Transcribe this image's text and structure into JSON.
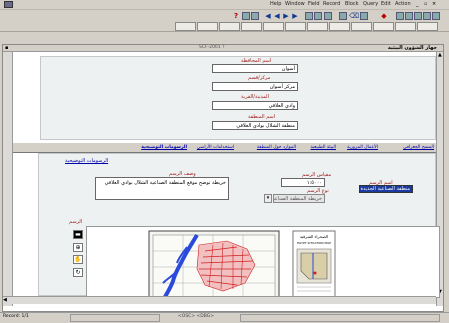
{
  "menu": {
    "items": [
      "Help",
      "Window",
      "Field",
      "Record",
      "Block",
      "Query",
      "Edit",
      "Action"
    ]
  },
  "window": {
    "title_left": "جهاز الشؤون البيئية",
    "title_center": "SCF-2001 ?"
  },
  "upper": {
    "governorate_label": "اسم المحافظة",
    "governorate_value": "أسوان",
    "markaz_label": "مركز/قسم",
    "markaz_value": "مركز أسوان",
    "city_label": "المدينة/القرية",
    "city_value": "وادي العلاقي",
    "area_label": "اسم المنطقة",
    "area_value": "منطقة الشلال بوادي العلاقي"
  },
  "tabs": [
    "المسح الجغرافي",
    "الأعمال المرورية",
    "البيئة الطبيعية",
    "الموارد حول المنطقة",
    "استخدامات الأراضي",
    "الرسومات التوضيحية"
  ],
  "lower": {
    "section_link": "الرسومات التوضيحية",
    "drawing_name_label": "اسم الرسم",
    "drawing_name_value": "منطقة الصناعية الجديدة",
    "scale_label": "مقياس الرسم",
    "scale_value": "١:٥٠٠٠",
    "drawing_type_label": "نوع الرسم",
    "drawing_type_value": "خريطة المنطقة الصناعية",
    "description_label": "وصف الرسم",
    "description_value": "خريطة توضح موقع المنطقة الصناعية الشلال بوادي العلاقي",
    "drawing_label": "الرسم"
  },
  "map": {
    "legend_title": "الصحراء الشرقية",
    "legend_caption": "EGYPT SITUATION MAP"
  },
  "status": {
    "left": "Record: 1/1",
    "middle": "<OSC> <DBG>"
  },
  "colors": {
    "label_red": "#a02020",
    "link_blue": "#0000aa",
    "selection": "#1a3aa0",
    "panel_bg": "#eef1f1",
    "river_blue": "#2a4adc",
    "urban_red": "#d02020"
  }
}
